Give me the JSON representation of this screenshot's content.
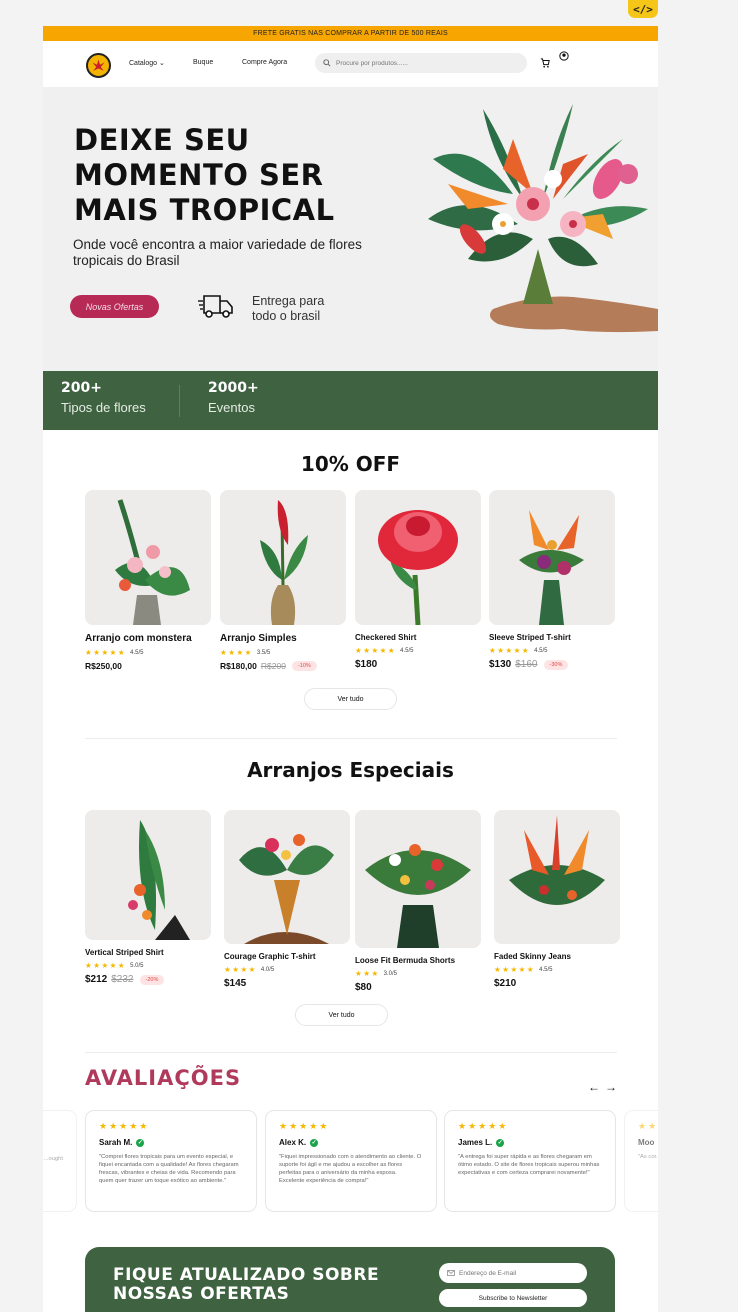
{
  "promo_bar": "FRETE GRATIS NAS COMPRAR A PARTIR DE 500 REAIS",
  "nav": {
    "catalog": "Catalogo",
    "bouquet": "Buque",
    "buy_now": "Compre Agora",
    "search_placeholder": "Procure por produtos......"
  },
  "hero": {
    "title": "DEIXE SEU MOMENTO SER MAIS TROPICAL",
    "subtitle": "Onde você encontra a maior variedade de flores tropicais do Brasil",
    "offer_button": "Novas Ofertas",
    "delivery": "Entrega para todo o brasil"
  },
  "stats": [
    {
      "num": "200+",
      "label": "Tipos de flores"
    },
    {
      "num": "2000+",
      "label": "Eventos"
    }
  ],
  "discount_section": {
    "title": "10% OFF",
    "products": [
      {
        "name": "Arranjo com monstera",
        "stars": "★★★★★",
        "rating": "4.5/5",
        "price": "R$250,00",
        "old_price": "",
        "discount": ""
      },
      {
        "name": "Arranjo Simples",
        "stars": "★★★★",
        "rating": "3.5/5",
        "price": "R$180,00",
        "old_price": "R$200",
        "discount": "-10%"
      },
      {
        "name": "Checkered Shirt",
        "stars": "★★★★★",
        "rating": "4.5/5",
        "price": "$180",
        "old_price": "",
        "discount": ""
      },
      {
        "name": "Sleeve Striped T-shirt",
        "stars": "★★★★★",
        "rating": "4.5/5",
        "price": "$130",
        "old_price": "$160",
        "discount": "-30%"
      }
    ],
    "view_all": "Ver tudo"
  },
  "special_section": {
    "title": "Arranjos Especiais",
    "products": [
      {
        "name": "Vertical Striped Shirt",
        "stars": "★★★★★",
        "rating": "5.0/5",
        "price": "$212",
        "old_price": "$232",
        "discount": "-20%"
      },
      {
        "name": "Courage Graphic T-shirt",
        "stars": "★★★★",
        "rating": "4.0/5",
        "price": "$145",
        "old_price": "",
        "discount": ""
      },
      {
        "name": "Loose Fit Bermuda Shorts",
        "stars": "★★★",
        "rating": "3.0/5",
        "price": "$80",
        "old_price": "",
        "discount": ""
      },
      {
        "name": "Faded Skinny Jeans",
        "stars": "★★★★★",
        "rating": "4.5/5",
        "price": "$210",
        "old_price": "",
        "discount": ""
      }
    ],
    "view_all": "Ver tudo"
  },
  "reviews": {
    "title": "AVALIAÇÕES",
    "items": [
      {
        "name": "Sarah M.",
        "stars": "★★★★★",
        "text": "\"Comprei flores tropicais para um evento especial, e fiquei encantada com a qualidade! As flores chegaram frescas, vibrantes e cheias de vida. Recomendo para quem quer trazer um toque exótico ao ambiente.\""
      },
      {
        "name": "Alex K.",
        "stars": "★★★★★",
        "text": "\"Fiquei impressionado com o atendimento ao cliente. O suporte foi ágil e me ajudou a escolher as flores perfeitas para o aniversário da minha esposa. Excelente experiência de compra!\""
      },
      {
        "name": "James L.",
        "stars": "★★★★★",
        "text": "\"A entrega foi super rápida e as flores chegaram em ótimo estado. O site de flores tropicais superou minhas expectativas e com certeza comprarei novamente!\""
      },
      {
        "name": "Moo",
        "stars": "★★",
        "text": "\"As cor... unique... stumbl... with fa..."
      }
    ],
    "left_partial_text": "...if the ...of ...ought"
  },
  "newsletter": {
    "title": "FIQUE ATUALIZADO SOBRE NOSSAS OFERTAS",
    "email_placeholder": "Endereço de E-mail",
    "button": "Subscribe to Newsletter"
  }
}
